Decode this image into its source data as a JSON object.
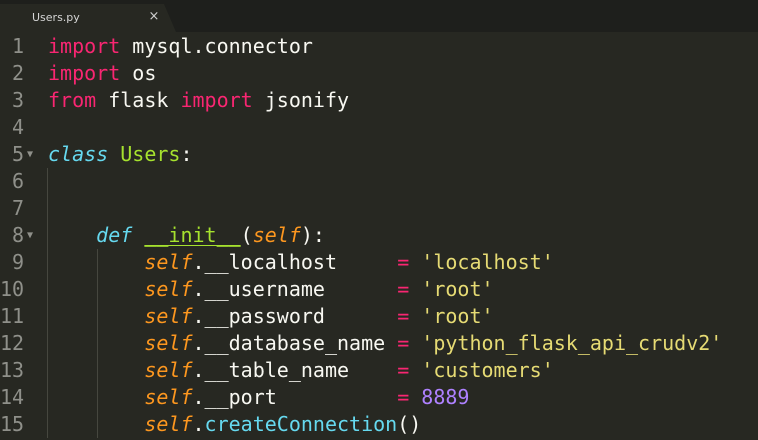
{
  "tab": {
    "title": "Users.py",
    "close_icon": "×"
  },
  "fold_icon": "▼",
  "lines": [
    {
      "n": "1",
      "fold": false,
      "indent": "",
      "tokens": [
        [
          "kw",
          "import"
        ],
        [
          "plain",
          " mysql.connector"
        ]
      ]
    },
    {
      "n": "2",
      "fold": false,
      "indent": "",
      "tokens": [
        [
          "kw",
          "import"
        ],
        [
          "plain",
          " os"
        ]
      ]
    },
    {
      "n": "3",
      "fold": false,
      "indent": "",
      "tokens": [
        [
          "kw",
          "from"
        ],
        [
          "plain",
          " flask "
        ],
        [
          "kw",
          "import"
        ],
        [
          "plain",
          " jsonify"
        ]
      ]
    },
    {
      "n": "4",
      "fold": false,
      "indent": "",
      "tokens": []
    },
    {
      "n": "5",
      "fold": true,
      "indent": "",
      "tokens": [
        [
          "st",
          "class"
        ],
        [
          "plain",
          " "
        ],
        [
          "cls",
          "Users"
        ],
        [
          "plain",
          ":"
        ]
      ]
    },
    {
      "n": "6",
      "fold": false,
      "indent": "",
      "tokens": []
    },
    {
      "n": "7",
      "fold": false,
      "indent": "",
      "tokens": []
    },
    {
      "n": "8",
      "fold": true,
      "indent": "    ",
      "tokens": [
        [
          "st",
          "def"
        ],
        [
          "plain",
          " "
        ],
        [
          "fn",
          "__init__"
        ],
        [
          "plain",
          "("
        ],
        [
          "slf",
          "self"
        ],
        [
          "plain",
          "):"
        ]
      ]
    },
    {
      "n": "9",
      "fold": false,
      "indent": "        ",
      "tokens": [
        [
          "slf",
          "self"
        ],
        [
          "plain",
          ".__localhost     "
        ],
        [
          "kw",
          "="
        ],
        [
          "plain",
          " "
        ],
        [
          "str",
          "'localhost'"
        ]
      ]
    },
    {
      "n": "10",
      "fold": false,
      "indent": "        ",
      "tokens": [
        [
          "slf",
          "self"
        ],
        [
          "plain",
          ".__username      "
        ],
        [
          "kw",
          "="
        ],
        [
          "plain",
          " "
        ],
        [
          "str",
          "'root'"
        ]
      ]
    },
    {
      "n": "11",
      "fold": false,
      "indent": "        ",
      "tokens": [
        [
          "slf",
          "self"
        ],
        [
          "plain",
          ".__password      "
        ],
        [
          "kw",
          "="
        ],
        [
          "plain",
          " "
        ],
        [
          "str",
          "'root'"
        ]
      ]
    },
    {
      "n": "12",
      "fold": false,
      "indent": "        ",
      "tokens": [
        [
          "slf",
          "self"
        ],
        [
          "plain",
          ".__database_name "
        ],
        [
          "kw",
          "="
        ],
        [
          "plain",
          " "
        ],
        [
          "str",
          "'python_flask_api_crudv2'"
        ]
      ]
    },
    {
      "n": "13",
      "fold": false,
      "indent": "        ",
      "tokens": [
        [
          "slf",
          "self"
        ],
        [
          "plain",
          ".__table_name    "
        ],
        [
          "kw",
          "="
        ],
        [
          "plain",
          " "
        ],
        [
          "str",
          "'customers'"
        ]
      ]
    },
    {
      "n": "14",
      "fold": false,
      "indent": "        ",
      "tokens": [
        [
          "slf",
          "self"
        ],
        [
          "plain",
          ".__port          "
        ],
        [
          "kw",
          "="
        ],
        [
          "plain",
          " "
        ],
        [
          "num",
          "8889"
        ]
      ]
    },
    {
      "n": "15",
      "fold": false,
      "indent": "        ",
      "tokens": [
        [
          "slf",
          "self"
        ],
        [
          "plain",
          "."
        ],
        [
          "call",
          "createConnection"
        ],
        [
          "plain",
          "()"
        ]
      ]
    }
  ],
  "colors": {
    "background": "#272822",
    "keyword": "#f92672",
    "storage": "#66d9ef",
    "class_name": "#a6e22e",
    "self": "#fd971f",
    "string": "#e6db74",
    "number": "#ae81ff",
    "line_number": "#8f908a"
  }
}
